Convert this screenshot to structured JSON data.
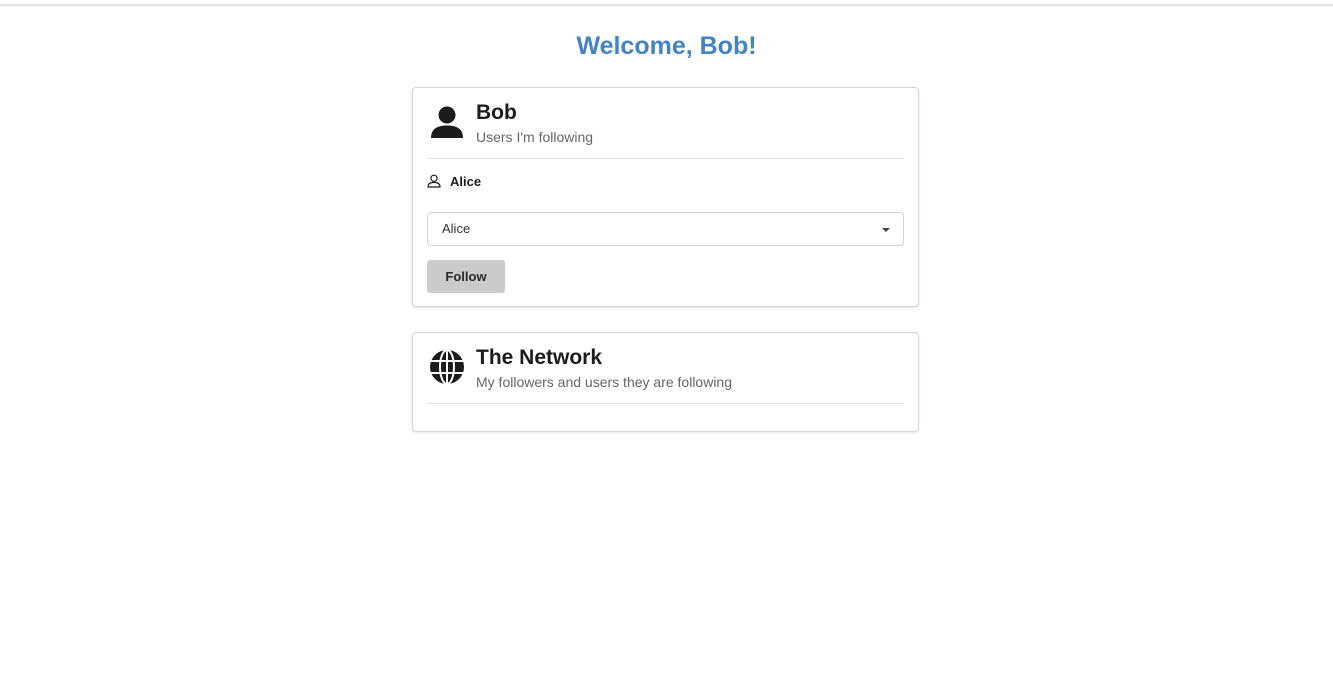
{
  "page": {
    "title": "Welcome, Bob!"
  },
  "me_card": {
    "icon": "user-icon",
    "title": "Bob",
    "subtitle": "Users I'm following",
    "following": [
      {
        "icon": "user-outline-icon",
        "name": "Alice"
      }
    ],
    "select": {
      "value": "Alice"
    },
    "follow_label": "Follow"
  },
  "network_card": {
    "icon": "globe-icon",
    "title": "The Network",
    "subtitle": "My followers and users they are following"
  },
  "colors": {
    "accent": "#4183c4",
    "button_bg": "#cacbcd",
    "border": "#d4d4d5"
  }
}
